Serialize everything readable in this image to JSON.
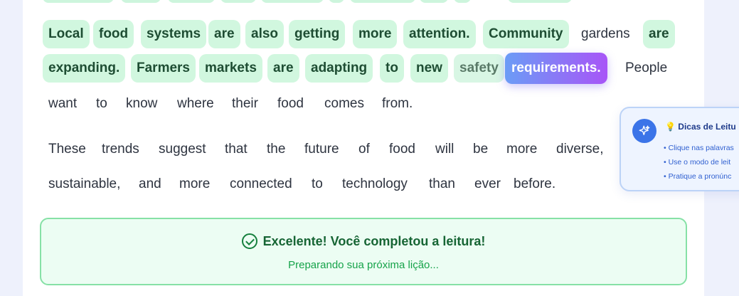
{
  "reading": {
    "lines": [
      [
        {
          "text": "Local",
          "state": "read"
        },
        {
          "text": "food",
          "state": "read"
        },
        {
          "text": "systems",
          "state": "read"
        },
        {
          "text": "are",
          "state": "read"
        },
        {
          "text": "also",
          "state": "read"
        },
        {
          "text": "getting",
          "state": "read"
        },
        {
          "text": "more",
          "state": "read"
        },
        {
          "text": "attention.",
          "state": "read"
        },
        {
          "text": "Community",
          "state": "read"
        },
        {
          "text": "gardens",
          "state": "unread"
        },
        {
          "text": "are",
          "state": "read"
        }
      ],
      [
        {
          "text": "expanding.",
          "state": "read"
        },
        {
          "text": "Farmers",
          "state": "read"
        },
        {
          "text": "markets",
          "state": "read"
        },
        {
          "text": "are",
          "state": "read"
        },
        {
          "text": "adapting",
          "state": "read"
        },
        {
          "text": "to",
          "state": "read"
        },
        {
          "text": "new",
          "state": "read"
        },
        {
          "text": "safety",
          "state": "fading"
        },
        {
          "text": "requirements.",
          "state": "active"
        },
        {
          "text": "People",
          "state": "unread"
        }
      ],
      [
        {
          "text": "want",
          "state": "unread"
        },
        {
          "text": "to",
          "state": "unread"
        },
        {
          "text": "know",
          "state": "unread"
        },
        {
          "text": "where",
          "state": "unread"
        },
        {
          "text": "their",
          "state": "unread"
        },
        {
          "text": "food",
          "state": "unread"
        },
        {
          "text": "comes",
          "state": "unread"
        },
        {
          "text": "from.",
          "state": "unread"
        }
      ],
      [
        {
          "text": "These",
          "state": "unread"
        },
        {
          "text": "trends",
          "state": "unread"
        },
        {
          "text": "suggest",
          "state": "unread"
        },
        {
          "text": "that",
          "state": "unread"
        },
        {
          "text": "the",
          "state": "unread"
        },
        {
          "text": "future",
          "state": "unread"
        },
        {
          "text": "of",
          "state": "unread"
        },
        {
          "text": "food",
          "state": "unread"
        },
        {
          "text": "will",
          "state": "unread"
        },
        {
          "text": "be",
          "state": "unread"
        },
        {
          "text": "more",
          "state": "unread"
        },
        {
          "text": "diverse,",
          "state": "unread"
        }
      ],
      [
        {
          "text": "sustainable,",
          "state": "unread"
        },
        {
          "text": "and",
          "state": "unread"
        },
        {
          "text": "more",
          "state": "unread"
        },
        {
          "text": "connected",
          "state": "unread"
        },
        {
          "text": "to",
          "state": "unread"
        },
        {
          "text": "technology",
          "state": "unread"
        },
        {
          "text": "than",
          "state": "unread"
        },
        {
          "text": "ever",
          "state": "unread"
        },
        {
          "text": "before.",
          "state": "unread"
        }
      ]
    ]
  },
  "completion": {
    "title": "Excelente! Você completou a leitura!",
    "subtitle": "Preparando sua próxima lição..."
  },
  "tips": {
    "icon": "lightbulb-icon",
    "title": "Dicas de Leitu",
    "items": [
      "• Clique nas palavras",
      "• Use o modo de leit",
      "• Pratique a pronúnc"
    ]
  },
  "colors": {
    "read_highlight": "#d1f7df",
    "active_gradient_start": "#6b9cf6",
    "active_gradient_end": "#a855f7",
    "success_green": "#16a34a",
    "tips_blue": "#3b74e8"
  }
}
